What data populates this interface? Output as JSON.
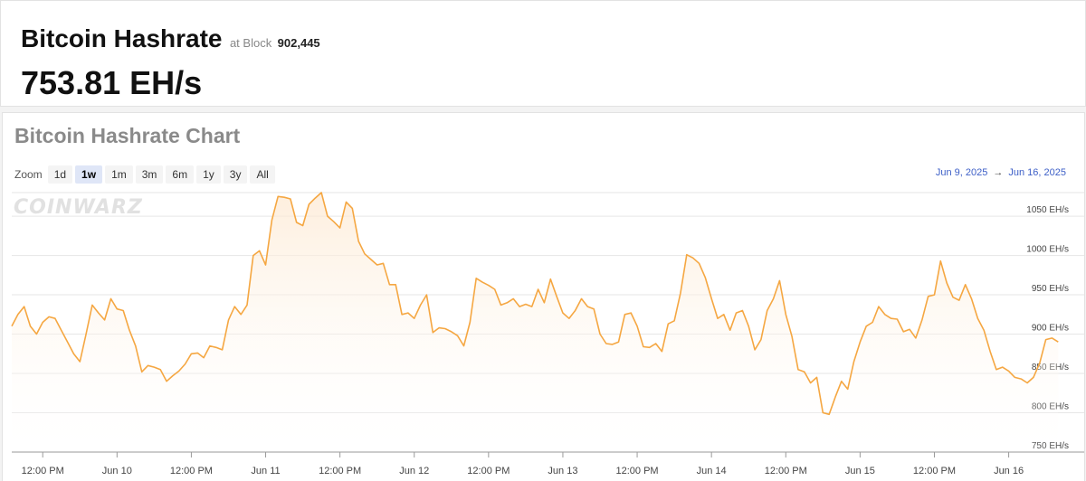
{
  "header": {
    "title": "Bitcoin Hashrate",
    "block_label": "at Block",
    "block_number": "902,445",
    "value": "753.81 EH/s"
  },
  "chart_card": {
    "title": "Bitcoin Hashrate Chart",
    "zoom_label": "Zoom",
    "zoom_options": [
      "1d",
      "1w",
      "1m",
      "3m",
      "6m",
      "1y",
      "3y",
      "All"
    ],
    "zoom_selected": "1w",
    "range_start": "Jun 9, 2025",
    "range_arrow": "→",
    "range_end": "Jun 16, 2025",
    "watermark": "COINWARZ"
  },
  "colors": {
    "line": "#f5a742",
    "fill_top": "#fde9d2",
    "range_link": "#3d5fc7"
  },
  "chart_data": {
    "type": "area",
    "title": "Bitcoin Hashrate Chart",
    "unit": "EH/s",
    "ylim": [
      750,
      1080
    ],
    "yticks": [
      750,
      800,
      850,
      900,
      950,
      1000,
      1050
    ],
    "ytick_labels": [
      "750 EH/s",
      "800 EH/s",
      "850 EH/s",
      "900 EH/s",
      "950 EH/s",
      "1000 EH/s",
      "1050 EH/s"
    ],
    "x_start": "2025-06-09T07:00",
    "x_end": "2025-06-16T10:00",
    "xticks": [
      {
        "t": "2025-06-09T12:00",
        "label": "12:00 PM"
      },
      {
        "t": "2025-06-10T00:00",
        "label": "Jun 10"
      },
      {
        "t": "2025-06-10T12:00",
        "label": "12:00 PM"
      },
      {
        "t": "2025-06-11T00:00",
        "label": "Jun 11"
      },
      {
        "t": "2025-06-11T12:00",
        "label": "12:00 PM"
      },
      {
        "t": "2025-06-12T00:00",
        "label": "Jun 12"
      },
      {
        "t": "2025-06-12T12:00",
        "label": "12:00 PM"
      },
      {
        "t": "2025-06-13T00:00",
        "label": "Jun 13"
      },
      {
        "t": "2025-06-13T12:00",
        "label": "12:00 PM"
      },
      {
        "t": "2025-06-14T00:00",
        "label": "Jun 14"
      },
      {
        "t": "2025-06-14T12:00",
        "label": "12:00 PM"
      },
      {
        "t": "2025-06-15T00:00",
        "label": "Jun 15"
      },
      {
        "t": "2025-06-15T12:00",
        "label": "12:00 PM"
      },
      {
        "t": "2025-06-16T00:00",
        "label": "Jun 16"
      }
    ],
    "grid": true,
    "legend": "none",
    "series": [
      {
        "values": [
          [
            "2025-06-09T07:00",
            910
          ],
          [
            "2025-06-09T08:00",
            925
          ],
          [
            "2025-06-09T09:00",
            935
          ],
          [
            "2025-06-09T10:00",
            910
          ],
          [
            "2025-06-09T11:00",
            900
          ],
          [
            "2025-06-09T12:00",
            915
          ],
          [
            "2025-06-09T13:00",
            922
          ],
          [
            "2025-06-09T14:00",
            920
          ],
          [
            "2025-06-09T15:00",
            905
          ],
          [
            "2025-06-09T16:00",
            890
          ],
          [
            "2025-06-09T17:00",
            875
          ],
          [
            "2025-06-09T18:00",
            865
          ],
          [
            "2025-06-09T19:00",
            900
          ],
          [
            "2025-06-09T20:00",
            937
          ],
          [
            "2025-06-09T21:00",
            927
          ],
          [
            "2025-06-09T22:00",
            918
          ],
          [
            "2025-06-09T23:00",
            945
          ],
          [
            "2025-06-10T00:00",
            932
          ],
          [
            "2025-06-10T01:00",
            930
          ],
          [
            "2025-06-10T02:00",
            905
          ],
          [
            "2025-06-10T03:00",
            885
          ],
          [
            "2025-06-10T04:00",
            852
          ],
          [
            "2025-06-10T05:00",
            860
          ],
          [
            "2025-06-10T06:00",
            858
          ],
          [
            "2025-06-10T07:00",
            855
          ],
          [
            "2025-06-10T08:00",
            840
          ],
          [
            "2025-06-10T09:00",
            847
          ],
          [
            "2025-06-10T10:00",
            853
          ],
          [
            "2025-06-10T11:00",
            862
          ],
          [
            "2025-06-10T12:00",
            875
          ],
          [
            "2025-06-10T13:00",
            876
          ],
          [
            "2025-06-10T14:00",
            870
          ],
          [
            "2025-06-10T15:00",
            885
          ],
          [
            "2025-06-10T16:00",
            883
          ],
          [
            "2025-06-10T17:00",
            880
          ],
          [
            "2025-06-10T18:00",
            918
          ],
          [
            "2025-06-10T19:00",
            935
          ],
          [
            "2025-06-10T20:00",
            925
          ],
          [
            "2025-06-10T21:00",
            937
          ],
          [
            "2025-06-10T22:00",
            1000
          ],
          [
            "2025-06-10T23:00",
            1006
          ],
          [
            "2025-06-11T00:00",
            988
          ],
          [
            "2025-06-11T01:00",
            1045
          ],
          [
            "2025-06-11T02:00",
            1075
          ],
          [
            "2025-06-11T03:00",
            1074
          ],
          [
            "2025-06-11T04:00",
            1072
          ],
          [
            "2025-06-11T05:00",
            1042
          ],
          [
            "2025-06-11T06:00",
            1038
          ],
          [
            "2025-06-11T07:00",
            1065
          ],
          [
            "2025-06-11T08:00",
            1073
          ],
          [
            "2025-06-11T09:00",
            1080
          ],
          [
            "2025-06-11T10:00",
            1050
          ],
          [
            "2025-06-11T11:00",
            1043
          ],
          [
            "2025-06-11T12:00",
            1035
          ],
          [
            "2025-06-11T13:00",
            1068
          ],
          [
            "2025-06-11T14:00",
            1060
          ],
          [
            "2025-06-11T15:00",
            1018
          ],
          [
            "2025-06-11T16:00",
            1002
          ],
          [
            "2025-06-11T17:00",
            995
          ],
          [
            "2025-06-11T18:00",
            988
          ],
          [
            "2025-06-11T19:00",
            990
          ],
          [
            "2025-06-11T20:00",
            963
          ],
          [
            "2025-06-11T21:00",
            963
          ],
          [
            "2025-06-11T22:00",
            925
          ],
          [
            "2025-06-11T23:00",
            927
          ],
          [
            "2025-06-12T00:00",
            920
          ],
          [
            "2025-06-12T01:00",
            937
          ],
          [
            "2025-06-12T02:00",
            950
          ],
          [
            "2025-06-12T03:00",
            902
          ],
          [
            "2025-06-12T04:00",
            908
          ],
          [
            "2025-06-12T05:00",
            907
          ],
          [
            "2025-06-12T06:00",
            903
          ],
          [
            "2025-06-12T07:00",
            898
          ],
          [
            "2025-06-12T08:00",
            885
          ],
          [
            "2025-06-12T09:00",
            915
          ],
          [
            "2025-06-12T10:00",
            971
          ],
          [
            "2025-06-12T11:00",
            966
          ],
          [
            "2025-06-12T12:00",
            962
          ],
          [
            "2025-06-12T13:00",
            957
          ],
          [
            "2025-06-12T14:00",
            937
          ],
          [
            "2025-06-12T15:00",
            940
          ],
          [
            "2025-06-12T16:00",
            945
          ],
          [
            "2025-06-12T17:00",
            935
          ],
          [
            "2025-06-12T18:00",
            938
          ],
          [
            "2025-06-12T19:00",
            935
          ],
          [
            "2025-06-12T20:00",
            957
          ],
          [
            "2025-06-12T21:00",
            940
          ],
          [
            "2025-06-12T22:00",
            970
          ],
          [
            "2025-06-12T23:00",
            948
          ],
          [
            "2025-06-13T00:00",
            927
          ],
          [
            "2025-06-13T01:00",
            920
          ],
          [
            "2025-06-13T02:00",
            930
          ],
          [
            "2025-06-13T03:00",
            945
          ],
          [
            "2025-06-13T04:00",
            935
          ],
          [
            "2025-06-13T05:00",
            932
          ],
          [
            "2025-06-13T06:00",
            900
          ],
          [
            "2025-06-13T07:00",
            888
          ],
          [
            "2025-06-13T08:00",
            887
          ],
          [
            "2025-06-13T09:00",
            890
          ],
          [
            "2025-06-13T10:00",
            925
          ],
          [
            "2025-06-13T11:00",
            927
          ],
          [
            "2025-06-13T12:00",
            910
          ],
          [
            "2025-06-13T13:00",
            884
          ],
          [
            "2025-06-13T14:00",
            883
          ],
          [
            "2025-06-13T15:00",
            888
          ],
          [
            "2025-06-13T16:00",
            878
          ],
          [
            "2025-06-13T17:00",
            913
          ],
          [
            "2025-06-13T18:00",
            917
          ],
          [
            "2025-06-13T19:00",
            952
          ],
          [
            "2025-06-13T20:00",
            1001
          ],
          [
            "2025-06-13T21:00",
            997
          ],
          [
            "2025-06-13T22:00",
            990
          ],
          [
            "2025-06-13T23:00",
            972
          ],
          [
            "2025-06-14T00:00",
            945
          ],
          [
            "2025-06-14T01:00",
            920
          ],
          [
            "2025-06-14T02:00",
            925
          ],
          [
            "2025-06-14T03:00",
            905
          ],
          [
            "2025-06-14T04:00",
            927
          ],
          [
            "2025-06-14T05:00",
            930
          ],
          [
            "2025-06-14T06:00",
            910
          ],
          [
            "2025-06-14T07:00",
            880
          ],
          [
            "2025-06-14T08:00",
            893
          ],
          [
            "2025-06-14T09:00",
            930
          ],
          [
            "2025-06-14T10:00",
            945
          ],
          [
            "2025-06-14T11:00",
            968
          ],
          [
            "2025-06-14T12:00",
            925
          ],
          [
            "2025-06-14T13:00",
            897
          ],
          [
            "2025-06-14T14:00",
            855
          ],
          [
            "2025-06-14T15:00",
            852
          ],
          [
            "2025-06-14T16:00",
            838
          ],
          [
            "2025-06-14T17:00",
            845
          ],
          [
            "2025-06-14T18:00",
            800
          ],
          [
            "2025-06-14T19:00",
            798
          ],
          [
            "2025-06-14T20:00",
            820
          ],
          [
            "2025-06-14T21:00",
            840
          ],
          [
            "2025-06-14T22:00",
            830
          ],
          [
            "2025-06-14T23:00",
            865
          ],
          [
            "2025-06-15T00:00",
            890
          ],
          [
            "2025-06-15T01:00",
            910
          ],
          [
            "2025-06-15T02:00",
            915
          ],
          [
            "2025-06-15T03:00",
            935
          ],
          [
            "2025-06-15T04:00",
            925
          ],
          [
            "2025-06-15T05:00",
            920
          ],
          [
            "2025-06-15T06:00",
            919
          ],
          [
            "2025-06-15T07:00",
            903
          ],
          [
            "2025-06-15T08:00",
            906
          ],
          [
            "2025-06-15T09:00",
            895
          ],
          [
            "2025-06-15T10:00",
            918
          ],
          [
            "2025-06-15T11:00",
            948
          ],
          [
            "2025-06-15T12:00",
            950
          ],
          [
            "2025-06-15T13:00",
            993
          ],
          [
            "2025-06-15T14:00",
            965
          ],
          [
            "2025-06-15T15:00",
            947
          ],
          [
            "2025-06-15T16:00",
            943
          ],
          [
            "2025-06-15T17:00",
            963
          ],
          [
            "2025-06-15T18:00",
            945
          ],
          [
            "2025-06-15T19:00",
            920
          ],
          [
            "2025-06-15T20:00",
            905
          ],
          [
            "2025-06-15T21:00",
            878
          ],
          [
            "2025-06-15T22:00",
            855
          ],
          [
            "2025-06-15T23:00",
            858
          ],
          [
            "2025-06-16T00:00",
            853
          ],
          [
            "2025-06-16T01:00",
            845
          ],
          [
            "2025-06-16T02:00",
            843
          ],
          [
            "2025-06-16T03:00",
            838
          ],
          [
            "2025-06-16T04:00",
            845
          ],
          [
            "2025-06-16T05:00",
            863
          ],
          [
            "2025-06-16T06:00",
            893
          ],
          [
            "2025-06-16T07:00",
            895
          ],
          [
            "2025-06-16T08:00",
            890
          ]
        ]
      }
    ]
  }
}
